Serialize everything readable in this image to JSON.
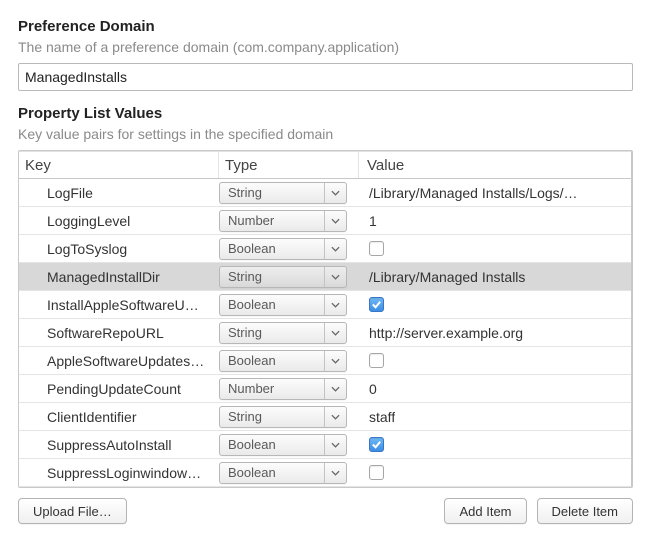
{
  "preference_domain": {
    "title": "Preference Domain",
    "subtitle": "The name of a preference domain (com.company.application)",
    "value": "ManagedInstalls"
  },
  "plist": {
    "title": "Property List Values",
    "subtitle": "Key value pairs for settings in the specified domain",
    "columns": {
      "key": "Key",
      "type": "Type",
      "value": "Value"
    },
    "rows": [
      {
        "key": "LogFile",
        "type": "String",
        "value_kind": "text",
        "value": "/Library/Managed Installs/Logs/…",
        "selected": false
      },
      {
        "key": "LoggingLevel",
        "type": "Number",
        "value_kind": "text",
        "value": "1",
        "selected": false
      },
      {
        "key": "LogToSyslog",
        "type": "Boolean",
        "value_kind": "check",
        "checked": false,
        "selected": false
      },
      {
        "key": "ManagedInstallDir",
        "type": "String",
        "value_kind": "text",
        "value": "/Library/Managed Installs",
        "selected": true
      },
      {
        "key": "InstallAppleSoftwareU…",
        "type": "Boolean",
        "value_kind": "check",
        "checked": true,
        "selected": false
      },
      {
        "key": "SoftwareRepoURL",
        "type": "String",
        "value_kind": "text",
        "value": "http://server.example.org",
        "selected": false
      },
      {
        "key": "AppleSoftwareUpdates…",
        "type": "Boolean",
        "value_kind": "check",
        "checked": false,
        "selected": false
      },
      {
        "key": "PendingUpdateCount",
        "type": "Number",
        "value_kind": "text",
        "value": "0",
        "selected": false
      },
      {
        "key": "ClientIdentifier",
        "type": "String",
        "value_kind": "text",
        "value": "staff",
        "selected": false
      },
      {
        "key": "SuppressAutoInstall",
        "type": "Boolean",
        "value_kind": "check",
        "checked": true,
        "selected": false
      },
      {
        "key": "SuppressLoginwindow…",
        "type": "Boolean",
        "value_kind": "check",
        "checked": false,
        "selected": false
      }
    ]
  },
  "buttons": {
    "upload": "Upload File…",
    "add": "Add Item",
    "delete": "Delete Item"
  }
}
